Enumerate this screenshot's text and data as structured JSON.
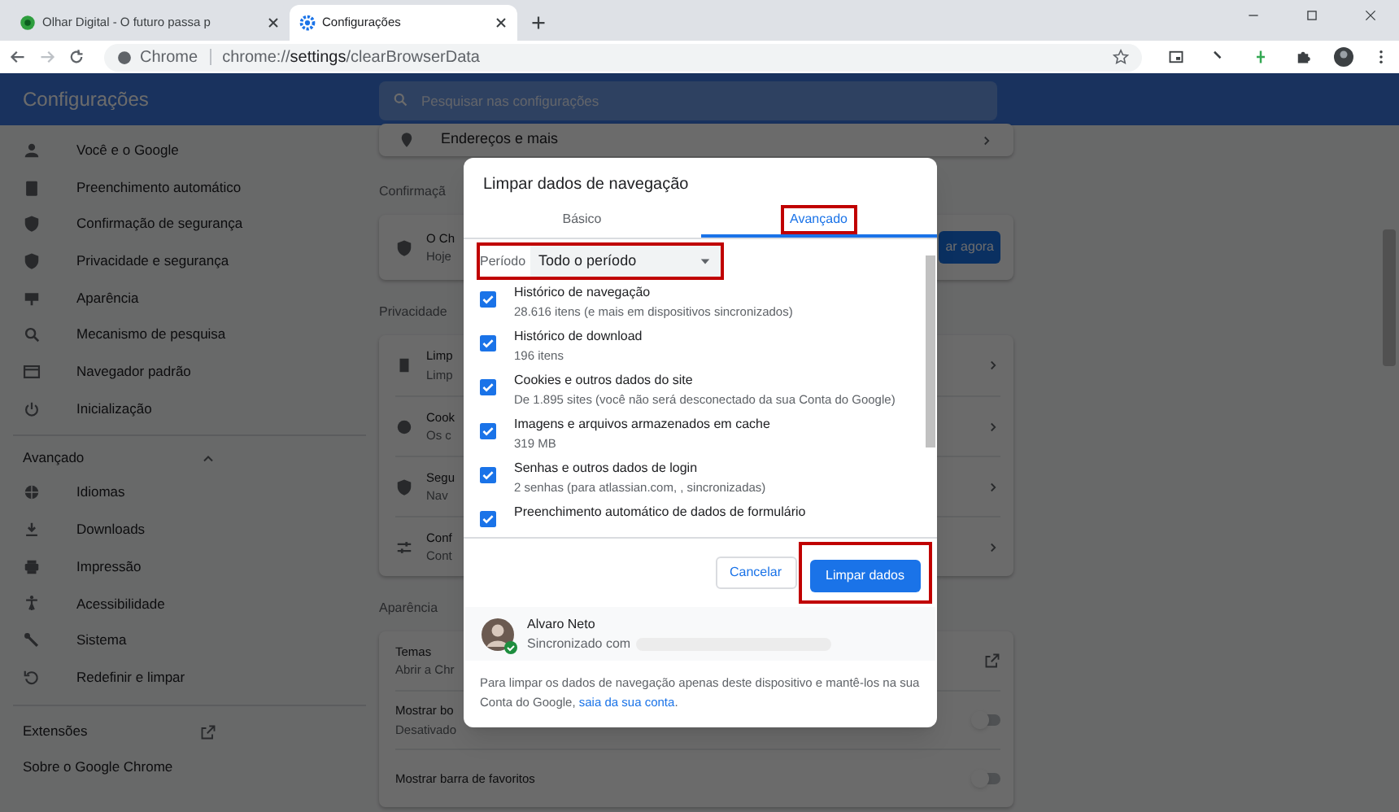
{
  "browser": {
    "tabs": [
      {
        "title": "Olhar Digital - O futuro passa p",
        "selected": false
      },
      {
        "title": "Configurações",
        "selected": true
      }
    ],
    "address": {
      "site": "Chrome",
      "url": "chrome://**settings**/clearBrowserData"
    }
  },
  "settings": {
    "title": "Configurações",
    "search": {
      "placeholder": "Pesquisar nas configurações"
    },
    "sidebar": [
      {
        "label": "Você e o Google"
      },
      {
        "label": "Preenchimento automático"
      },
      {
        "label": "Confirmação de segurança"
      },
      {
        "label": "Privacidade e segurança"
      },
      {
        "label": "Aparência"
      },
      {
        "label": "Mecanismo de pesquisa"
      },
      {
        "label": "Navegador padrão"
      },
      {
        "label": "Inicialização"
      }
    ],
    "advanced": {
      "label": "Avançado",
      "expanded": true,
      "items": [
        {
          "label": "Idiomas"
        },
        {
          "label": "Downloads"
        },
        {
          "label": "Impressão"
        },
        {
          "label": "Acessibilidade"
        },
        {
          "label": "Sistema"
        },
        {
          "label": "Redefinir e limpar"
        }
      ]
    },
    "extensions": "Extensões",
    "about": "Sobre o Google Chrome",
    "top_row": "Endereços e mais",
    "safety": {
      "heading": "Confirmaçã",
      "title": "O Ch",
      "subtitle": "Hoje",
      "button": "ar agora"
    },
    "privacy": {
      "heading": "Privacidade",
      "rows": [
        {
          "title": "Limp",
          "subtitle": "Limp"
        },
        {
          "title": "Cook",
          "subtitle": "Os c"
        },
        {
          "title": "Segu",
          "subtitle": "Nav"
        },
        {
          "title": "Conf",
          "subtitle": "Cont"
        }
      ]
    },
    "appearance": {
      "heading": "Aparência",
      "rows": [
        {
          "kind": "link",
          "title": "Temas",
          "subtitle": "Abrir a Chr"
        },
        {
          "kind": "toggle",
          "title": "Mostrar bo",
          "subtitle": "Desativado",
          "on": false
        },
        {
          "kind": "toggle",
          "title": "Mostrar barra de favoritos",
          "on": false
        }
      ]
    }
  },
  "dialog": {
    "title": "Limpar dados de navegação",
    "tabs": [
      {
        "label": "Básico",
        "selected": false
      },
      {
        "label": "Avançado",
        "selected": true
      }
    ],
    "period": {
      "label": "Período",
      "value": "Todo o período"
    },
    "items": [
      {
        "title": "Histórico de navegação",
        "subtitle": "28.616 itens (e mais em dispositivos sincronizados)",
        "checked": true
      },
      {
        "title": "Histórico de download",
        "subtitle": "196 itens",
        "checked": true
      },
      {
        "title": "Cookies e outros dados do site",
        "subtitle": "De 1.895 sites (você não será desconectado da sua Conta do Google)",
        "checked": true
      },
      {
        "title": "Imagens e arquivos armazenados em cache",
        "subtitle": "319 MB",
        "checked": true
      },
      {
        "title": "Senhas e outros dados de login",
        "subtitle": "2 senhas (para atlassian.com, , sincronizadas)",
        "checked": true
      },
      {
        "title": "Preenchimento automático de dados de formulário",
        "checked": true
      }
    ],
    "cancel": "Cancelar",
    "confirm": "Limpar dados",
    "account": {
      "name": "Alvaro Neto",
      "status": "Sincronizado com"
    },
    "footer": {
      "text": "Para limpar os dados de navegação apenas deste dispositivo e mantê-los na sua Conta do Google,",
      "link": "saia da sua conta",
      "end": "."
    }
  }
}
